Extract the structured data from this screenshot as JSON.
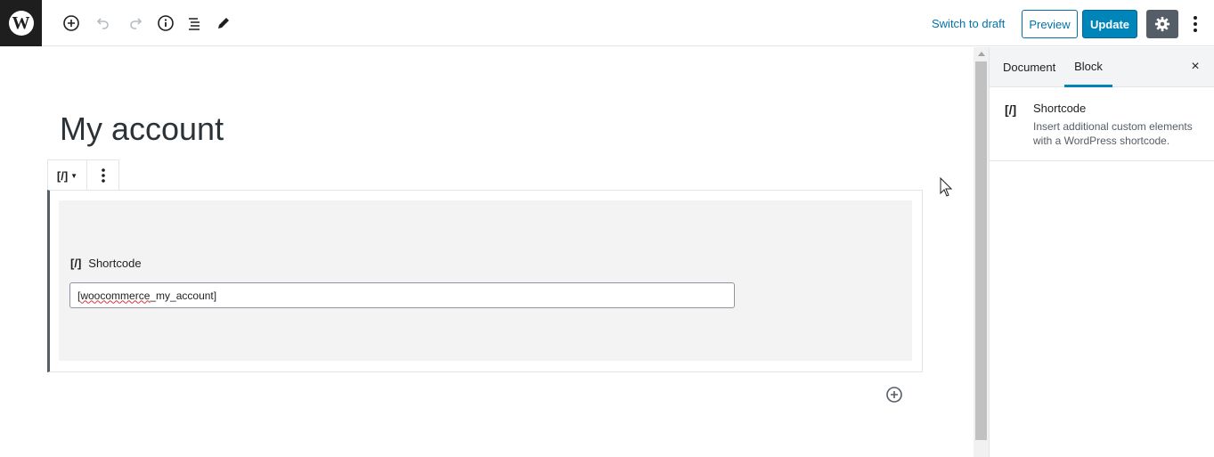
{
  "topbar": {
    "switch_to_draft": "Switch to draft",
    "preview": "Preview",
    "update": "Update",
    "icons": [
      "add-block-icon",
      "undo-icon",
      "redo-icon",
      "info-icon",
      "list-view-icon",
      "edit-icon",
      "gear-icon",
      "more-vertical-icon"
    ]
  },
  "editor": {
    "title": "My account",
    "block_switcher_icon": "[/]",
    "shortcode_icon": "[/]",
    "shortcode_label": "Shortcode",
    "shortcode_value_prefix": "[",
    "shortcode_value_spell": "woocommerce",
    "shortcode_value_rest": "_my_account]"
  },
  "sidebar": {
    "tabs": [
      {
        "label": "Document",
        "active": false
      },
      {
        "label": "Block",
        "active": true
      }
    ],
    "close_icon": "×",
    "block_card": {
      "icon": "[/]",
      "title": "Shortcode",
      "description": "Insert additional custom elements with a WordPress shortcode."
    }
  },
  "colors": {
    "accent": "#0085ba",
    "link": "#0073aa",
    "dark": "#1e1e1e"
  }
}
